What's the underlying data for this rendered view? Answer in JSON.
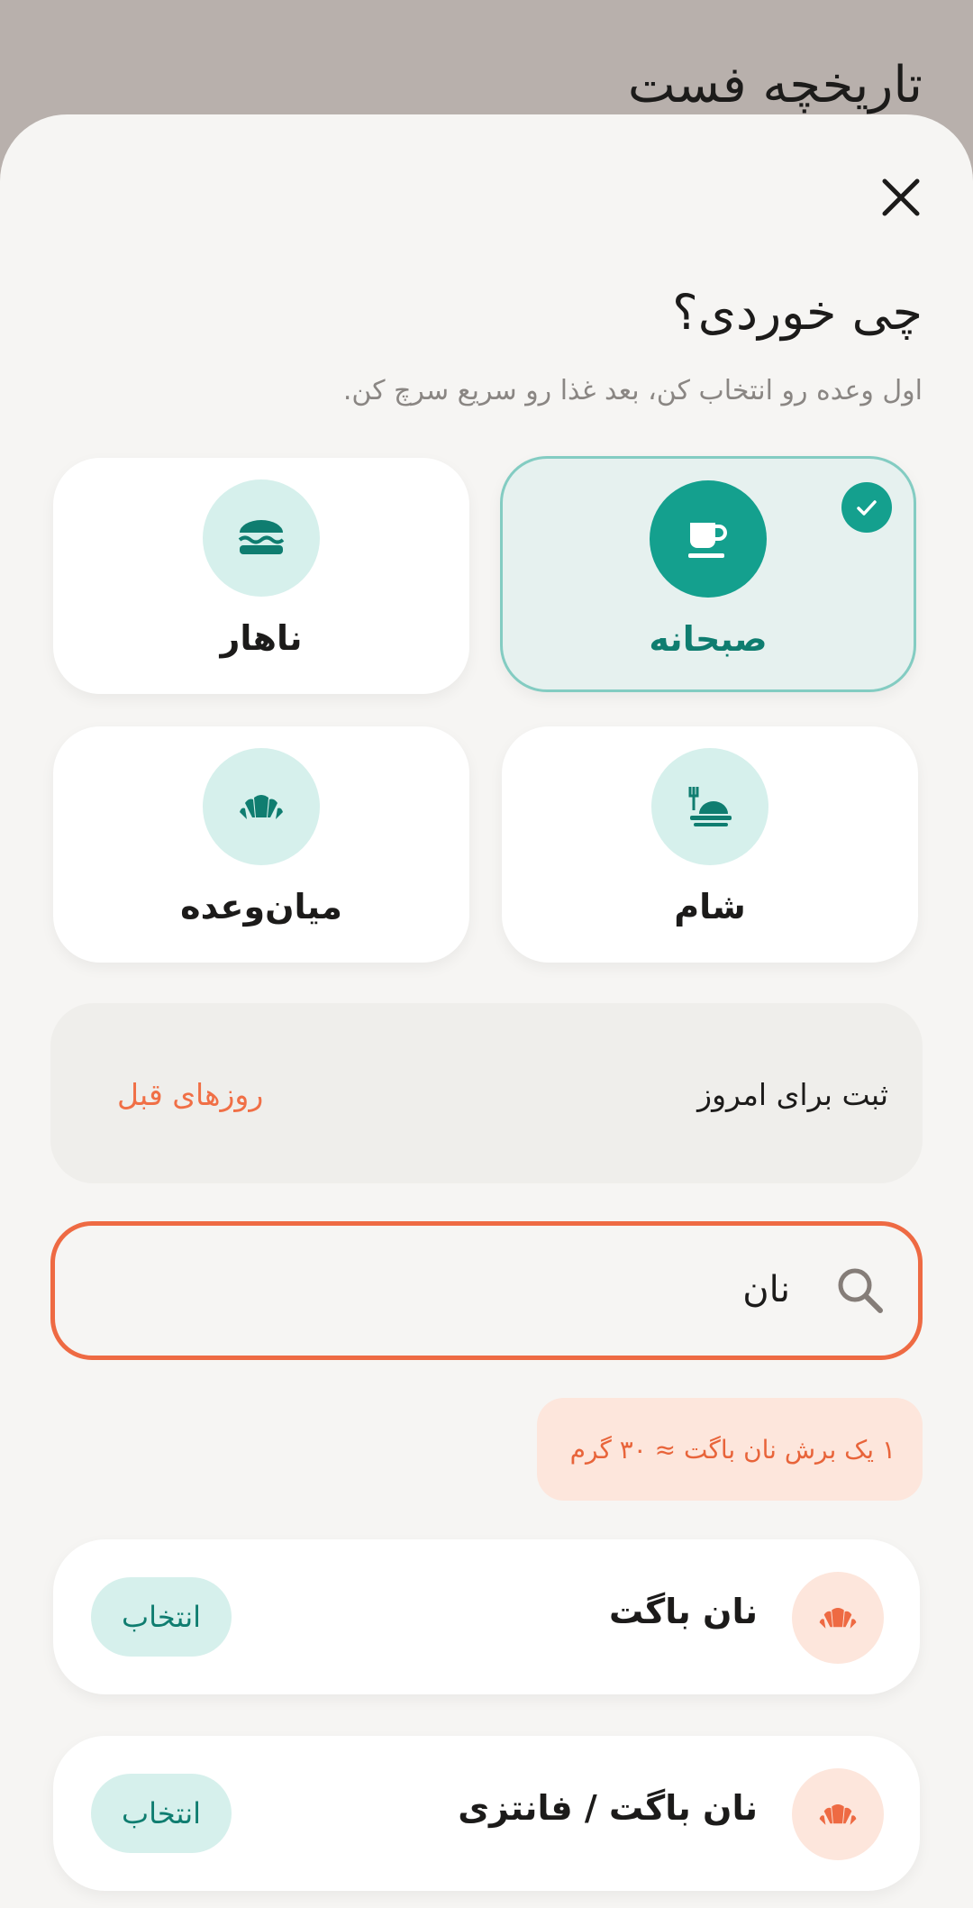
{
  "background": {
    "title": "تاریخچه فست"
  },
  "sheet": {
    "title": "چی خوردی؟",
    "subtitle": "اول وعده رو انتخاب کن، بعد غذا رو سریع سرچ کن.",
    "close_icon": "close-icon"
  },
  "meals": [
    {
      "label": "صبحانه",
      "icon": "coffee-cup-icon",
      "selected": true
    },
    {
      "label": "ناهار",
      "icon": "burger-icon",
      "selected": false
    },
    {
      "label": "شام",
      "icon": "dinner-plate-icon",
      "selected": false
    },
    {
      "label": "میان‌وعده",
      "icon": "croissant-icon",
      "selected": false
    }
  ],
  "date": {
    "today_label": "ثبت برای امروز",
    "previous_label": "روزهای قبل"
  },
  "search": {
    "value": "نان",
    "icon": "search-icon"
  },
  "hint": {
    "text": "۱ یک برش نان باگت ≈ ۳۰ گرم"
  },
  "foods": [
    {
      "name": "نان باگت",
      "icon": "croissant-icon",
      "action": "انتخاب"
    },
    {
      "name": "نان باگت / فانتزی",
      "icon": "croissant-icon",
      "action": "انتخاب"
    }
  ],
  "colors": {
    "accent_teal": "#14a08e",
    "accent_orange": "#ee6a43",
    "sheet_bg": "#f6f5f3",
    "backdrop": "#b8b0ac"
  }
}
